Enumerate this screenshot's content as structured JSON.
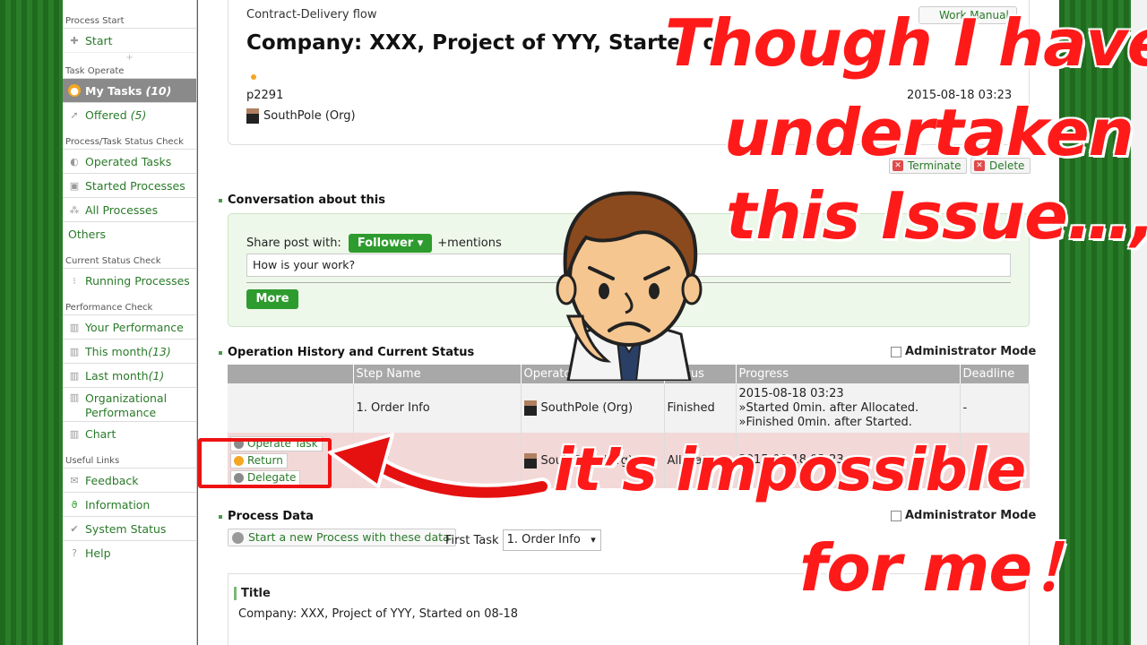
{
  "sidebar": {
    "sections": [
      {
        "heading": "Process Start",
        "items": [
          {
            "label": "Start",
            "icon": "plus-icon"
          }
        ]
      },
      {
        "heading": "Task Operate",
        "items": [
          {
            "label": "My Tasks",
            "count": "(10)",
            "icon": "task-icon"
          },
          {
            "label": "Offered",
            "count": "(5)",
            "icon": "offer-icon"
          }
        ]
      },
      {
        "heading": "Process/Task Status Check",
        "items": [
          {
            "label": "Operated Tasks",
            "icon": "operated-icon"
          },
          {
            "label": "Started Processes",
            "icon": "started-icon"
          },
          {
            "label": "All Processes",
            "icon": "all-icon"
          },
          {
            "label": "Others",
            "icon": ""
          }
        ]
      },
      {
        "heading": "Current Status Check",
        "items": [
          {
            "label": "Running Processes",
            "icon": "running-icon"
          }
        ]
      },
      {
        "heading": "Performance Check",
        "items": [
          {
            "label": "Your Performance",
            "icon": "bar-chart-icon"
          },
          {
            "label": "This month",
            "count": "(13)",
            "icon": "bar-chart-icon"
          },
          {
            "label": "Last month",
            "count": "(1)",
            "icon": "bar-chart-icon"
          },
          {
            "label": "Organizational Performance",
            "icon": "bar-chart-icon"
          },
          {
            "label": "Chart",
            "icon": "bar-chart-icon"
          }
        ]
      },
      {
        "heading": "Useful Links",
        "items": [
          {
            "label": "Feedback",
            "icon": "feedback-icon"
          },
          {
            "label": "Information",
            "icon": "info-icon"
          },
          {
            "label": "System Status",
            "icon": "status-icon"
          },
          {
            "label": "Help",
            "icon": "help-icon"
          }
        ]
      }
    ],
    "plus": "+"
  },
  "header": {
    "flow": "Contract-Delivery flow",
    "work_manual": "Work Manual",
    "title": "Company: XXX, Project of YYY, Started o",
    "pid": "p2291",
    "date": "2015-08-18 03:23",
    "owner": "SouthPole (Org)",
    "terminate": "Terminate",
    "delete": "Delete"
  },
  "conversation": {
    "title": "Conversation about this",
    "share_label": "Share post with:",
    "follower": "Follower",
    "mentions": "+mentions",
    "input_value": "How is your work?",
    "more": "More"
  },
  "history": {
    "title": "Operation History and Current Status",
    "admin_mode": "Administrator Mode",
    "headers": [
      "",
      "Step Name",
      "Operator",
      "Status",
      "Progress",
      "Deadline"
    ],
    "rows": [
      {
        "step": "1. Order Info",
        "operator": "SouthPole (Org)",
        "status": "Finished",
        "progress": [
          "2015-08-18 03:23",
          "»Started 0min. after Allocated.",
          "»Finished 0min. after Started."
        ],
        "deadline": "-"
      },
      {
        "step": "2. ...k",
        "operator": "SouthPole (Org)",
        "status": "Allocated",
        "progress": [
          "2015-08-18 03:23",
          ""
        ],
        "deadline": "",
        "ops": [
          "Operate Task",
          "Return",
          "Delegate"
        ]
      }
    ]
  },
  "process_data": {
    "title": "Process Data",
    "admin_mode": "Administrator Mode",
    "start_btn": "Start a new Process with these data",
    "first_task_label": "First Task",
    "first_task_value": "1. Order Info",
    "field_label": "Title",
    "field_value": "Company: XXX, Project of YYY, Started on 08-18"
  },
  "overlay": {
    "caption_lines": [
      "Though I have",
      "undertaken",
      "this Issue…,"
    ],
    "caption_bottom": [
      "it’s impossible",
      "for me！"
    ],
    "colors": {
      "caption": "#ff1a1a",
      "outline": "#ffffff",
      "box": "#ee1111"
    }
  }
}
